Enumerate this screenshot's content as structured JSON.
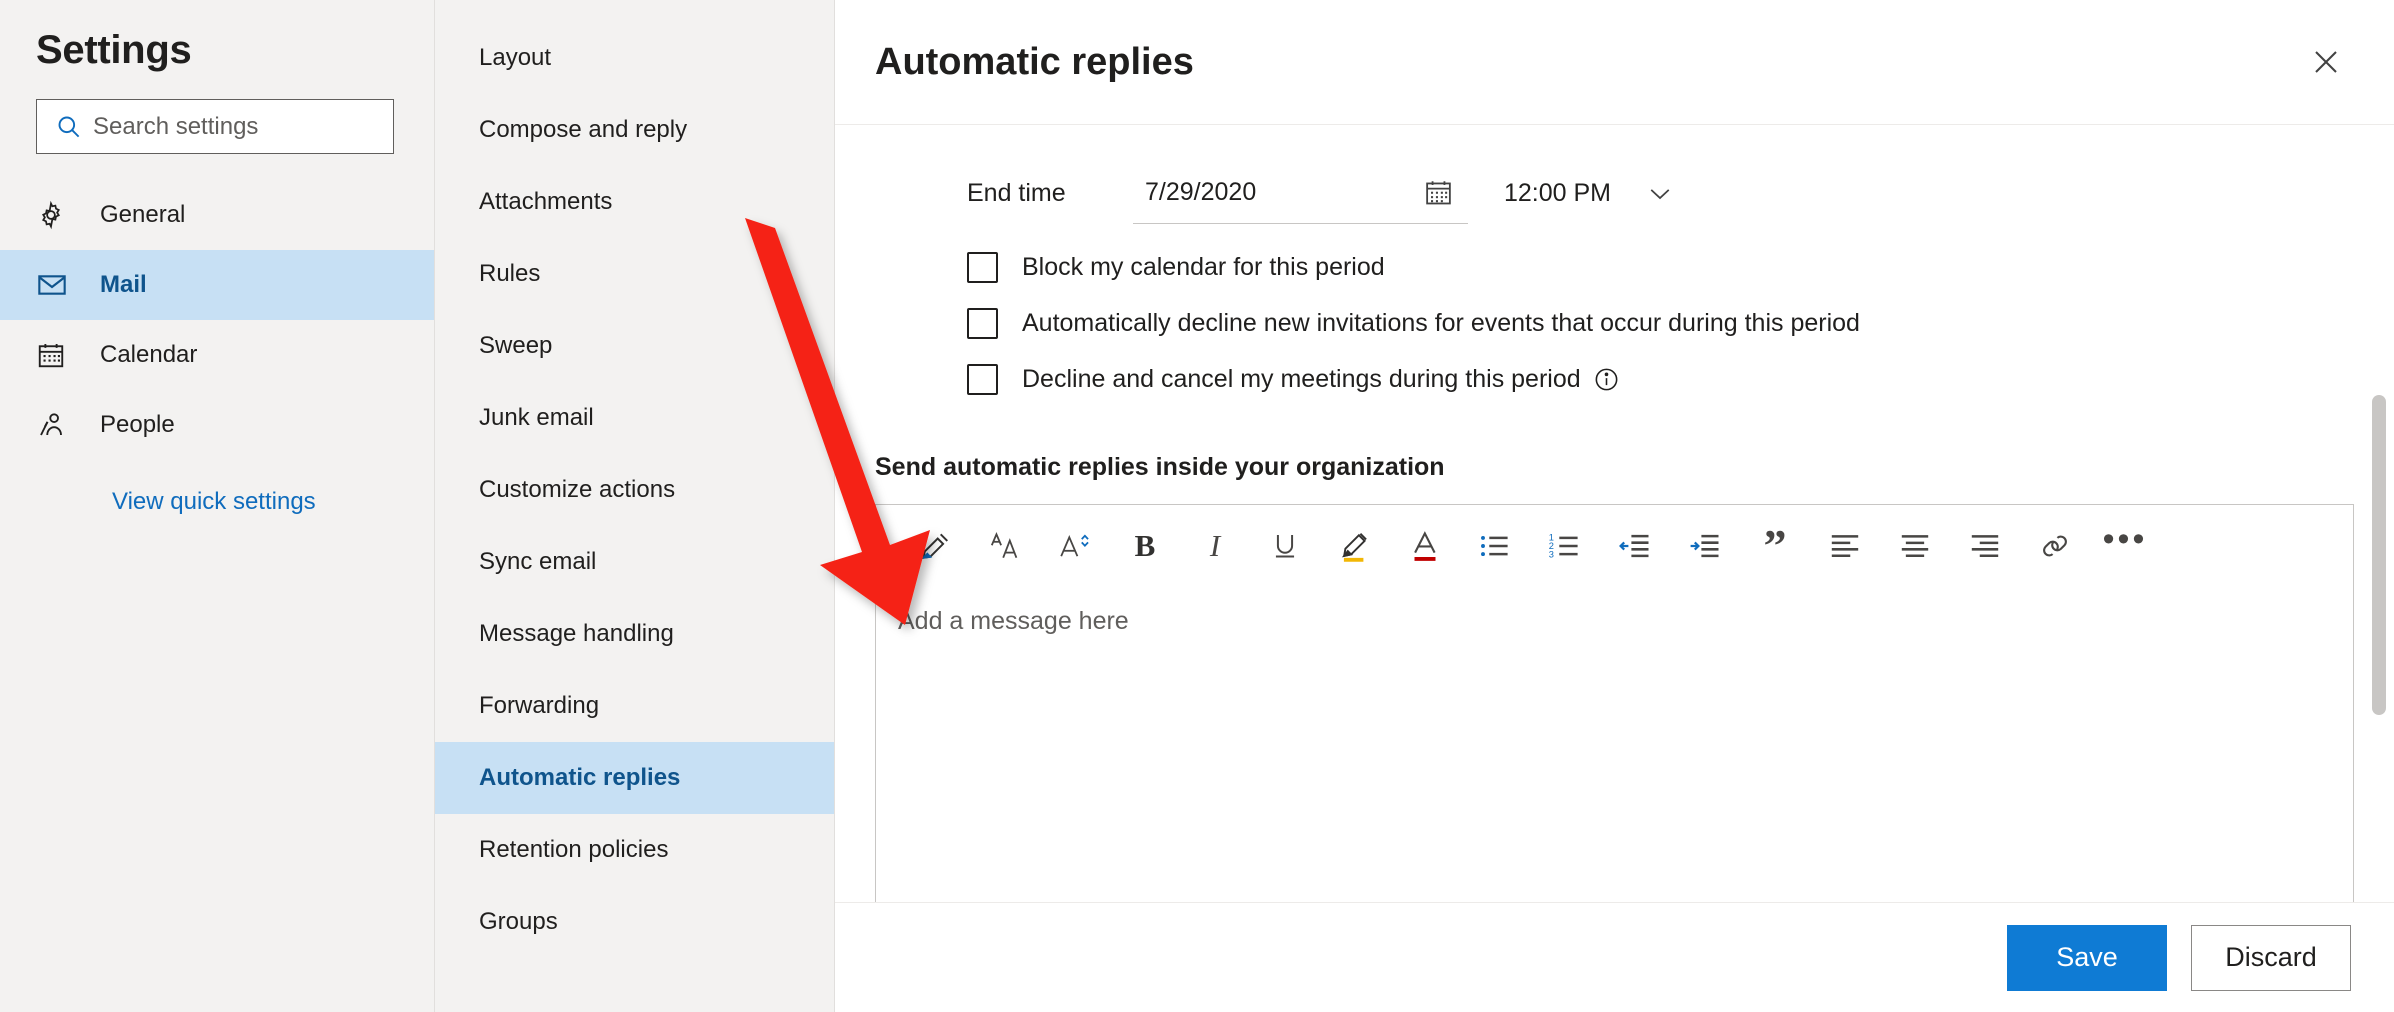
{
  "settings_pane": {
    "title": "Settings",
    "search": {
      "placeholder": "Search settings",
      "value": "",
      "icon": "search-icon"
    },
    "items": [
      {
        "label": "General",
        "icon": "gear-icon",
        "selected": false
      },
      {
        "label": "Mail",
        "icon": "envelope-icon",
        "selected": true
      },
      {
        "label": "Calendar",
        "icon": "calendar-icon",
        "selected": false
      },
      {
        "label": "People",
        "icon": "people-icon",
        "selected": false
      }
    ],
    "quick_settings_link": "View quick settings"
  },
  "subnav": {
    "items": [
      {
        "label": "Layout",
        "selected": false
      },
      {
        "label": "Compose and reply",
        "selected": false
      },
      {
        "label": "Attachments",
        "selected": false
      },
      {
        "label": "Rules",
        "selected": false
      },
      {
        "label": "Sweep",
        "selected": false
      },
      {
        "label": "Junk email",
        "selected": false
      },
      {
        "label": "Customize actions",
        "selected": false
      },
      {
        "label": "Sync email",
        "selected": false
      },
      {
        "label": "Message handling",
        "selected": false
      },
      {
        "label": "Forwarding",
        "selected": false
      },
      {
        "label": "Automatic replies",
        "selected": true
      },
      {
        "label": "Retention policies",
        "selected": false
      },
      {
        "label": "Groups",
        "selected": false
      }
    ]
  },
  "detail": {
    "title": "Automatic replies",
    "close_icon": "close-icon",
    "end_time": {
      "label": "End time",
      "date_value": "7/29/2020",
      "calendar_icon": "calendar-icon",
      "time_value": "12:00 PM",
      "chevron_icon": "chevron-down-icon"
    },
    "checkboxes": [
      {
        "label": "Block my calendar for this period",
        "checked": false,
        "info": false
      },
      {
        "label": "Automatically decline new invitations for events that occur during this period",
        "checked": false,
        "info": false
      },
      {
        "label": "Decline and cancel my meetings during this period",
        "checked": false,
        "info": true,
        "info_icon": "info-icon"
      }
    ],
    "section_heading": "Send automatic replies inside your organization",
    "toolbar": [
      {
        "name": "format-painter-icon",
        "glyph": ""
      },
      {
        "name": "font-size-icon",
        "glyph": ""
      },
      {
        "name": "font-grow-icon",
        "glyph": ""
      },
      {
        "name": "bold-icon",
        "glyph": "B"
      },
      {
        "name": "italic-icon",
        "glyph": "I"
      },
      {
        "name": "underline-icon",
        "glyph": ""
      },
      {
        "name": "highlight-icon",
        "glyph": ""
      },
      {
        "name": "font-color-icon",
        "glyph": ""
      },
      {
        "name": "bulleted-list-icon",
        "glyph": ""
      },
      {
        "name": "numbered-list-icon",
        "glyph": ""
      },
      {
        "name": "decrease-indent-icon",
        "glyph": ""
      },
      {
        "name": "increase-indent-icon",
        "glyph": ""
      },
      {
        "name": "quote-icon",
        "glyph": "”"
      },
      {
        "name": "align-left-icon",
        "glyph": ""
      },
      {
        "name": "align-center-icon",
        "glyph": ""
      },
      {
        "name": "align-right-icon",
        "glyph": ""
      },
      {
        "name": "link-icon",
        "glyph": ""
      },
      {
        "name": "more-options-icon",
        "glyph": "•••"
      }
    ],
    "message": {
      "placeholder": "Add a message here",
      "value": ""
    },
    "footer": {
      "save_label": "Save",
      "discard_label": "Discard"
    }
  },
  "colors": {
    "accent_blue": "#0f6cbd",
    "selected_bg": "#c7e0f4",
    "selected_text": "#0f548c",
    "sidebar_bg": "#f3f2f1",
    "save_button": "#0f7bd4",
    "annotation_red": "#f52314",
    "highlight_yellow": "#f2b705",
    "font_color_red": "#c00000"
  },
  "annotation": {
    "type": "arrow",
    "color": "#f52314"
  }
}
